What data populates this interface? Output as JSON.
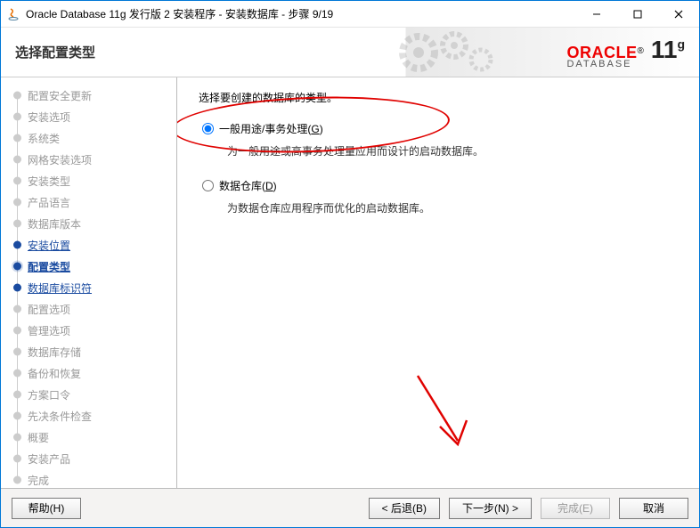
{
  "window": {
    "title": "Oracle Database 11g 发行版 2 安装程序 - 安装数据库 - 步骤 9/19"
  },
  "banner": {
    "title": "选择配置类型",
    "brand": "ORACLE",
    "product_line": "DATABASE",
    "version": "11",
    "version_suffix": "g"
  },
  "steps": [
    {
      "label": "配置安全更新",
      "state": "disabled"
    },
    {
      "label": "安装选项",
      "state": "disabled"
    },
    {
      "label": "系统类",
      "state": "disabled"
    },
    {
      "label": "网格安装选项",
      "state": "disabled"
    },
    {
      "label": "安装类型",
      "state": "disabled"
    },
    {
      "label": "产品语言",
      "state": "disabled"
    },
    {
      "label": "数据库版本",
      "state": "disabled"
    },
    {
      "label": "安装位置",
      "state": "done"
    },
    {
      "label": "配置类型",
      "state": "active"
    },
    {
      "label": "数据库标识符",
      "state": "next"
    },
    {
      "label": "配置选项",
      "state": "disabled"
    },
    {
      "label": "管理选项",
      "state": "disabled"
    },
    {
      "label": "数据库存储",
      "state": "disabled"
    },
    {
      "label": "备份和恢复",
      "state": "disabled"
    },
    {
      "label": "方案口令",
      "state": "disabled"
    },
    {
      "label": "先决条件检查",
      "state": "disabled"
    },
    {
      "label": "概要",
      "state": "disabled"
    },
    {
      "label": "安装产品",
      "state": "disabled"
    },
    {
      "label": "完成",
      "state": "disabled"
    }
  ],
  "content": {
    "prompt": "选择要创建的数据库的类型。",
    "options": [
      {
        "value": "general",
        "label": "一般用途/事务处理(G)",
        "label_plain": "一般用途/事务处理",
        "accelerator": "G",
        "desc": "为一般用途或高事务处理量应用而设计的启动数据库。",
        "selected": true
      },
      {
        "value": "warehouse",
        "label": "数据仓库(D)",
        "label_plain": "数据仓库",
        "accelerator": "D",
        "desc": "为数据仓库应用程序而优化的启动数据库。",
        "selected": false
      }
    ]
  },
  "buttons": {
    "help": "帮助(H)",
    "back": "< 后退(B)",
    "next": "下一步(N) >",
    "finish": "完成(E)",
    "cancel": "取消"
  }
}
